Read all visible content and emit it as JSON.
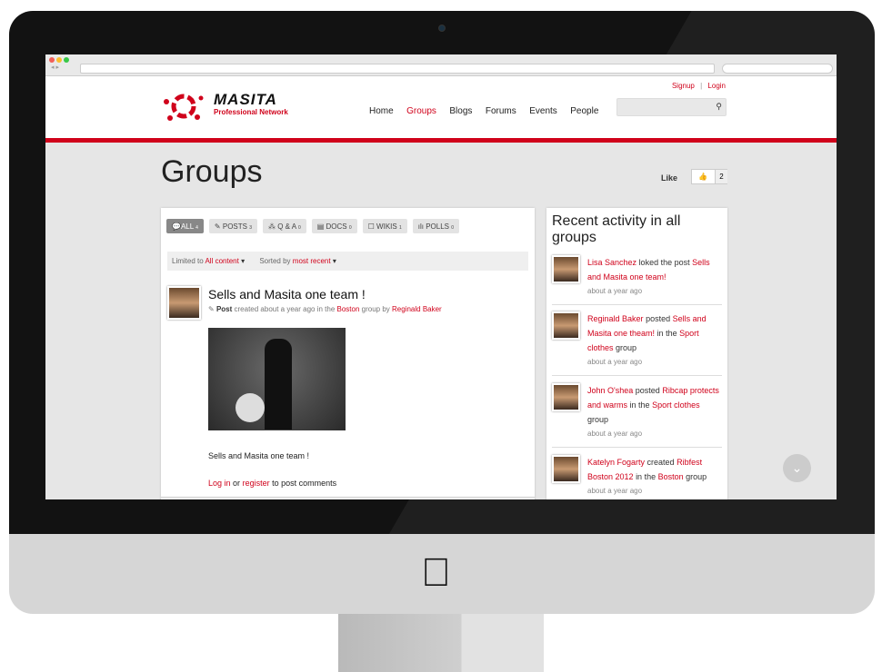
{
  "header": {
    "signup": "Signup",
    "login": "Login",
    "logo_text": "MASITA",
    "logo_sub": "Professional Network",
    "nav": [
      "Home",
      "Groups",
      "Blogs",
      "Forums",
      "Events",
      "People"
    ],
    "active_nav": "Groups"
  },
  "page": {
    "title": "Groups",
    "like_label": "Like",
    "like_count": "2"
  },
  "tabs": [
    {
      "label": "ALL",
      "count": "4",
      "icon": "comments-icon"
    },
    {
      "label": "POSTS",
      "count": "3",
      "icon": "pencil-icon"
    },
    {
      "label": "Q & A",
      "count": "0",
      "icon": "question-icon"
    },
    {
      "label": "DOCS",
      "count": "0",
      "icon": "document-icon"
    },
    {
      "label": "WIKIS",
      "count": "1",
      "icon": "edit-icon"
    },
    {
      "label": "POLLS",
      "count": "0",
      "icon": "bar-chart-icon"
    }
  ],
  "filter": {
    "limited_label": "Limited to",
    "limited_value": "All content",
    "sorted_label": "Sorted by",
    "sorted_value": "most recent"
  },
  "post": {
    "title": "Sells and Masita one team !",
    "type": "Post",
    "meta1": "created about a year ago in the",
    "group": "Boston",
    "meta2": "group by",
    "author": "Reginald Baker",
    "body": "Sells and Masita one team !",
    "login": "Log in",
    "or": "or",
    "register": "register",
    "comment_suffix": "to post comments"
  },
  "sidebar": {
    "title": "Recent activity in all groups",
    "items": [
      {
        "user": "Lisa Sanchez",
        "verb": "loked the post",
        "target": "Sells and Masita one team!",
        "tail": "",
        "group": "",
        "group_suffix": "",
        "time": "about a year ago"
      },
      {
        "user": "Reginald Baker",
        "verb": "posted",
        "target": "Sells and Masita one theam!",
        "tail": "in the",
        "group": "Sport clothes",
        "group_suffix": "group",
        "time": "about a year ago"
      },
      {
        "user": "John O'shea",
        "verb": "posted",
        "target": "Ribcap protects and warms",
        "tail": "in the",
        "group": "Sport clothes",
        "group_suffix": "group",
        "time": "about a year ago"
      },
      {
        "user": "Katelyn Fogarty",
        "verb": "created",
        "target": "Ribfest Boston 2012",
        "tail": "in the",
        "group": "Boston",
        "group_suffix": "group",
        "time": "about a year ago"
      }
    ]
  },
  "colors": {
    "accent": "#d0021b",
    "bezel": "#121212",
    "background": "#e6e6e6"
  }
}
